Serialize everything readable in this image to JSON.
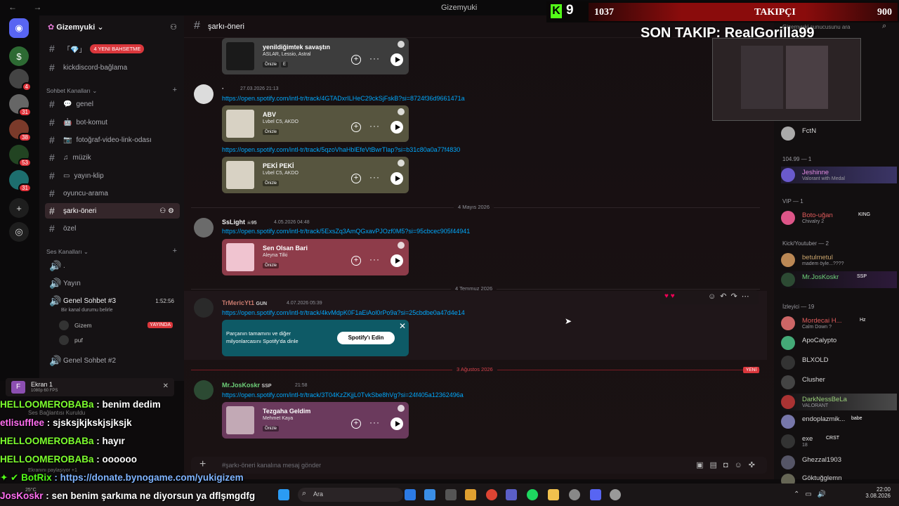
{
  "window": {
    "title": "Gizemyuki"
  },
  "server": {
    "name": "Gizemyuki"
  },
  "overlay": {
    "k_logo": "K",
    "k_num": "9",
    "followers_count": "1037",
    "followers_label": "TAKIPÇI",
    "followers_goal": "900",
    "last_follow": "SON TAKIP: RealGorilla99",
    "search_placeholder": "Gizemyuki sunucusunu ara"
  },
  "channels": {
    "top_item_label": "「💎」",
    "top_item_badge": "4 YENI BAHSETME",
    "kick_link": "kickdiscord-bağlama",
    "cat_text": "Sohbet Kanalları",
    "text_channels": [
      "genel",
      "bot-komut",
      "fotoğraf-video-link-odası",
      "müzik",
      "yayın-klip",
      "oyuncu-arama",
      "şarkı-öneri",
      "özel"
    ],
    "cat_voice": "Ses Kanalları",
    "voice_channels": [
      ".",
      "Yayın",
      "Genel Sohbet #3",
      "Genel Sohbet #2"
    ],
    "voice_time": "1:52:56",
    "voice_status": "Bir kanal durumu belirle",
    "voice_users": [
      "Gizem",
      "puf"
    ],
    "live_label": "YAYINDA",
    "screen_title": "Ekran 1",
    "screen_sub": "1080p 60 FPS",
    "voice_connected": "Ses Bağlantısı Kuruldu",
    "sharing": "Ekranını paylaşıyor +1"
  },
  "header": {
    "channel": "şarkı-öneri"
  },
  "messages": [
    {
      "card": {
        "title": "yenildiğimtek savaştın",
        "artist": "ASLAR, Lessio, Astral",
        "preview": "Önizle",
        "explicit": "E"
      }
    },
    {
      "user": "·",
      "time": "27.03.2026 21:13",
      "link": "https://open.spotify.com/intl-tr/track/4GTADxrILHeC29ckSjFskB?si=8724f36d9661471a",
      "card": {
        "title": "ABV",
        "artist": "Lvbel C5, AKDO",
        "preview": "Önizle"
      }
    },
    {
      "link": "https://open.spotify.com/intl-tr/track/5qzoVhaHblEfeVtBwrTlap?si=b31c80a0a77f4830",
      "card": {
        "title": "PEKİ PEKİ",
        "artist": "Lvbel C5, AKDO",
        "preview": "Önizle"
      }
    },
    {
      "user": "SsLight",
      "user_tag": "☠95",
      "time": "4.05.2026 04:48",
      "link": "https://open.spotify.com/intl-tr/track/5ExsZq3AmQGxavPJOzf0M5?si=95cbcec905f44941",
      "card": {
        "title": "Sen Olsan Bari",
        "artist": "Aleyna Tilki",
        "preview": "Önizle"
      }
    },
    {
      "user": "TrMericYt1",
      "user_tag": "GUN",
      "time": "4.07.2026 05:39",
      "link": "https://open.spotify.com/intl-tr/track/4kvMdpK0F1aEiAol0rPo9a?si=25cbdbe0a47d4e14",
      "promo": {
        "text": "Parçanın tamamını ve diğer milyonlarcasını Spotify'da dinle",
        "button": "Spotify'ı Edin"
      }
    },
    {
      "user": "Mr.JosKoskr",
      "user_tag": "SSP",
      "time": "21:58",
      "link": "https://open.spotify.com/intl-tr/track/3T04KzZKjjL0TvkSbe8hVg?si=24f405a12362496a",
      "card": {
        "title": "Tezgaha Geldim",
        "artist": "Mehmet Kaya",
        "preview": "Önizle"
      }
    }
  ],
  "dividers": [
    "4 Mayıs 2026",
    "4 Temmuz 2026",
    "3 Ağustos 2026"
  ],
  "new_label": "YENİ",
  "input": {
    "placeholder": "#şarkı-öneri kanalına mesaj gönder"
  },
  "members": {
    "first": {
      "name": "FctN"
    },
    "sections": [
      "104.99 — 1",
      "VIP — 1",
      "Kick/Youtuber — 2",
      "İzleyici — 19"
    ],
    "list": [
      {
        "name": "Jeshinne",
        "status": "Valorant with Medal"
      },
      {
        "name": "Boto-uğan",
        "status": "Chivalry 2",
        "tag": "KING"
      },
      {
        "name": "betulmetul",
        "status": "madem öyle...????"
      },
      {
        "name": "Mr.JosKoskr",
        "tag": "SSP"
      },
      {
        "name": "Mordecai H...",
        "status": "Calm Down ?",
        "tag": "Hz"
      },
      {
        "name": "ApoCalypto"
      },
      {
        "name": "BLXOLD"
      },
      {
        "name": "Clusher"
      },
      {
        "name": "DarkNessBeLa",
        "status": "VALORANT"
      },
      {
        "name": "endoplazmik...",
        "tag": "babe"
      },
      {
        "name": "exe",
        "status": "18",
        "tag": "CRST"
      },
      {
        "name": "Ghezzal1903"
      },
      {
        "name": "Göktuğglemn"
      }
    ]
  },
  "chat": [
    {
      "user": "HELLOOMEROBABa",
      "text": ": benim dedim",
      "color": "#7dff2e"
    },
    {
      "user": "etlisufflee",
      "text": ": sjsksjkjkskjsjksjk",
      "color": "#ff6ef0"
    },
    {
      "user": "HELLOOMEROBABa",
      "text": ": hayır",
      "color": "#7dff2e"
    },
    {
      "user": "HELLOOMEROBABa",
      "text": ": oooooo",
      "color": "#7dff2e"
    },
    {
      "user": "BotRix",
      "text": ": https://donate.bynogame.com/yukigizem",
      "color": "#53fc18",
      "text_color": "#7fb4ff"
    },
    {
      "user": "JosKoskr",
      "text": ": sen benim şarkıma ne diyorsun ya dflşmgdfg",
      "color": "#ff6ef0"
    }
  ],
  "taskbar": {
    "search": "Ara",
    "time": "22:00",
    "date": "3.08.2026",
    "weather": "25°C"
  },
  "colors": {
    "accent_red": "#da373c",
    "link": "#00a8fc",
    "kick_green": "#53fc18"
  }
}
